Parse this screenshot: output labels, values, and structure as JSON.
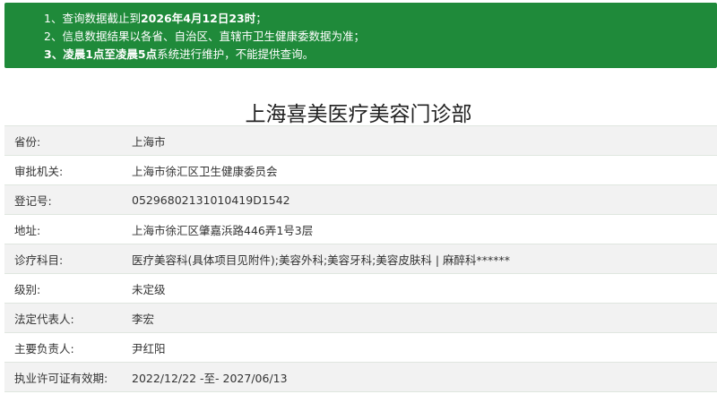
{
  "notice": {
    "lines": [
      {
        "prefix": "1、查询数据截止到",
        "bold": "2026年4月12日23时",
        "suffix": "；"
      },
      {
        "prefix": "2、信息数据结果以各省、自治区、直辖市卫生健康委数据为准；",
        "bold": "",
        "suffix": ""
      },
      {
        "prefix": "3、",
        "bold": "凌晨1点至凌晨5点",
        "suffix": "系统进行维护，不能提供查询。"
      }
    ]
  },
  "page_title": "上海喜美医疗美容门诊部",
  "rows": [
    {
      "label": "省份:",
      "value": "上海市"
    },
    {
      "label": "审批机关:",
      "value": "上海市徐汇区卫生健康委员会"
    },
    {
      "label": "登记号:",
      "value": "05296802131010419D1542"
    },
    {
      "label": "地址:",
      "value": "上海市徐汇区肇嘉浜路446弄1号3层"
    },
    {
      "label": "诊疗科目:",
      "value": "医疗美容科(具体项目见附件);美容外科;美容牙科;美容皮肤科 | 麻醉科******"
    },
    {
      "label": "级别:",
      "value": "未定级"
    },
    {
      "label": "法定代表人:",
      "value": "李宏"
    },
    {
      "label": "主要负责人:",
      "value": "尹红阳"
    },
    {
      "label": "执业许可证有效期:",
      "value": "2022/12/22 -至- 2027/06/13"
    }
  ],
  "colors": {
    "notice_bg": "#1f8a3a",
    "row_alt_bg": "#f2f2f2"
  }
}
